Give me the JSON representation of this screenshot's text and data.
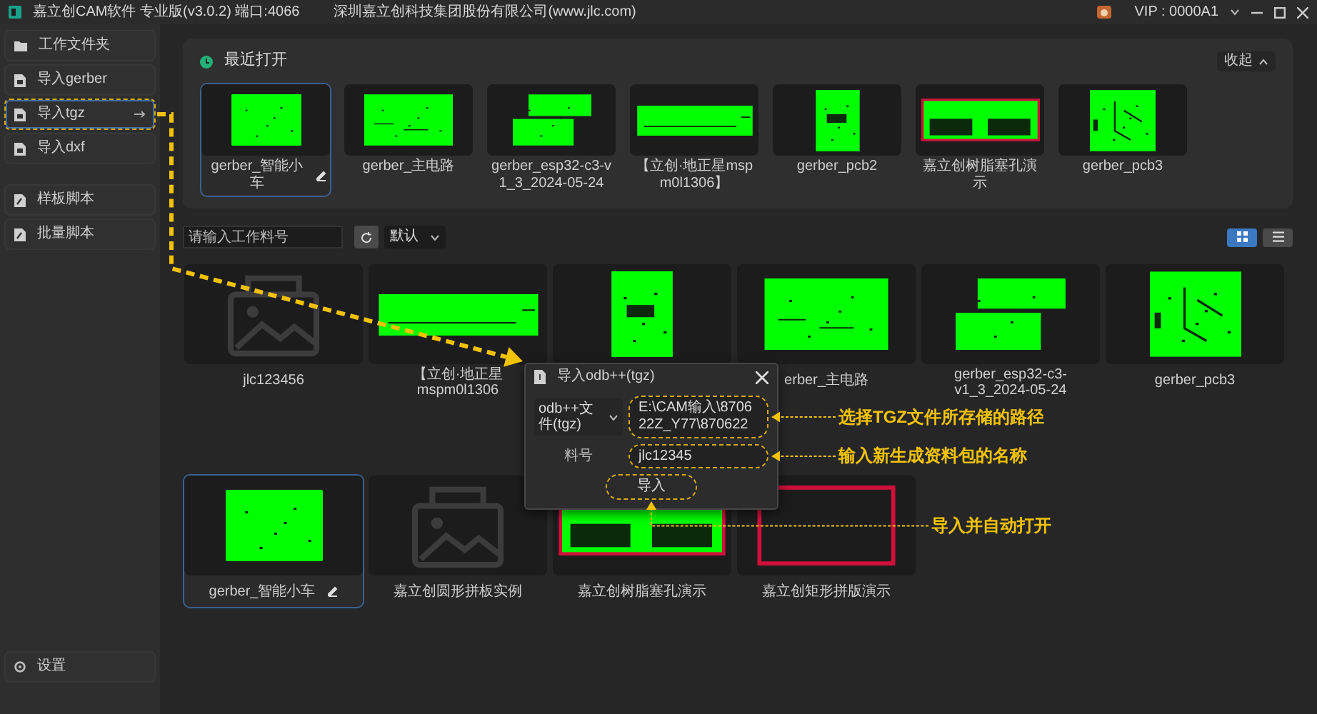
{
  "title_bar": {
    "app_title": "嘉立创CAM软件 专业版(v3.0.2) 端口:4066",
    "company": "深圳嘉立创科技集团股份有限公司(www.jlc.com)",
    "account": "VIP : 0000A1"
  },
  "sidebar": {
    "import_items": [
      {
        "label": "工作文件夹",
        "kind": "folder",
        "selected": false,
        "highlighted": false
      },
      {
        "label": "导入gerber",
        "kind": "file",
        "selected": false,
        "highlighted": false
      },
      {
        "label": "导入tgz",
        "kind": "file",
        "selected": true,
        "highlighted": true
      },
      {
        "label": "导入dxf",
        "kind": "file",
        "selected": false,
        "highlighted": false
      }
    ],
    "script_items": [
      {
        "label": "样板脚本",
        "kind": "script",
        "selected": false,
        "highlighted": false
      },
      {
        "label": "批量脚本",
        "kind": "script",
        "selected": false,
        "highlighted": false
      }
    ],
    "settings": "设置"
  },
  "recent": {
    "title": "最近打开",
    "collapse_button": "收起",
    "items": [
      {
        "label": "gerber_智能小车",
        "kind": "board-rect",
        "selected": true
      },
      {
        "label": "gerber_主电路",
        "kind": "board-wide",
        "selected": false
      },
      {
        "label": "gerber_esp32-c3-v1_3_2024-05-24",
        "kind": "board-twin",
        "selected": false
      },
      {
        "label": "【立创·地正星mspm0l1306】",
        "kind": "board-strip",
        "selected": false
      },
      {
        "label": "gerber_pcb2",
        "kind": "board-tall",
        "selected": false
      },
      {
        "label": "嘉立创树脂塞孔演示",
        "kind": "board-framed",
        "selected": false
      },
      {
        "label": "gerber_pcb3",
        "kind": "board-square",
        "selected": false
      }
    ]
  },
  "toolbar": {
    "search": {
      "placeholder": "请输入工作料号"
    },
    "sort": "默认",
    "views": [
      {
        "kind": "grid",
        "selected": true
      },
      {
        "kind": "list",
        "selected": false
      }
    ]
  },
  "grid": {
    "items": [
      {
        "label": "jlc123456",
        "kind": "placeholder",
        "selected": false
      },
      {
        "label": "【立创·地正星mspm0l1306",
        "kind": "board-strip",
        "selected": false
      },
      {
        "kind": "board-tall",
        "selected": false
      },
      {
        "label": "erber_主电路",
        "kind": "board-wide",
        "selected": false
      },
      {
        "label": "gerber_esp32-c3-v1_3_2024-05-24",
        "kind": "board-twin",
        "selected": false
      },
      {
        "label": "gerber_pcb3",
        "kind": "board-square",
        "selected": false
      },
      {
        "label": "gerber_智能小车",
        "kind": "board-rect",
        "selected": true
      },
      {
        "label": "嘉立创圆形拼板实例",
        "kind": "placeholder",
        "selected": false
      },
      {
        "label": "嘉立创树脂塞孔演示",
        "kind": "board-framed",
        "selected": false
      },
      {
        "label": "嘉立创矩形拼版演示",
        "kind": "outline",
        "selected": false
      }
    ]
  },
  "dialog": {
    "title": "导入odb++(tgz)",
    "file_type": "odb++文件(tgz)",
    "path_field": {
      "value": "E:\\CAM输入\\870622Z_Y77\\870622",
      "highlighted": true
    },
    "name_label": "料号",
    "name_field": {
      "value": "jlc12345",
      "highlighted": true
    },
    "import_button": {
      "label": "导入",
      "highlighted": true
    }
  },
  "annotations": [
    {
      "kind": "path",
      "text": "选择TGZ文件所存储的路径"
    },
    {
      "kind": "name",
      "text": "输入新生成资料包的名称"
    },
    {
      "kind": "import",
      "text": "导入并自动打开"
    }
  ]
}
